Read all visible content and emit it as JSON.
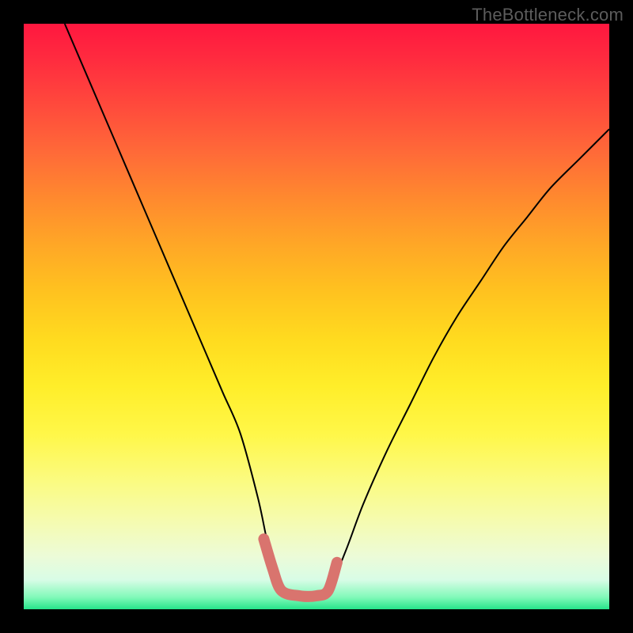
{
  "watermark": {
    "text": "TheBottleneck.com"
  },
  "chart_data": {
    "type": "line",
    "title": "",
    "xlabel": "",
    "ylabel": "",
    "xlim": [
      0,
      100
    ],
    "ylim": [
      0,
      100
    ],
    "grid": false,
    "legend": false,
    "series": [
      {
        "name": "curve",
        "color": "#000000",
        "stroke_width": 2,
        "x": [
          7,
          10,
          13,
          16,
          19,
          22,
          25,
          28,
          31,
          34,
          37,
          40,
          41.5,
          43,
          45,
          47,
          50,
          52,
          55,
          58,
          62,
          66,
          70,
          74,
          78,
          82,
          86,
          90,
          95,
          100
        ],
        "y": [
          100,
          93,
          86,
          79,
          72,
          65,
          58,
          51,
          44,
          37,
          30,
          19,
          12,
          6,
          3,
          2,
          2,
          3,
          10,
          18,
          27,
          35,
          43,
          50,
          56,
          62,
          67,
          72,
          77,
          82
        ]
      },
      {
        "name": "flat-highlight",
        "color": "#d9746e",
        "stroke_width": 14,
        "linecap": "round",
        "x": [
          41,
          42.5,
          44,
          47,
          50,
          52,
          53.5
        ],
        "y": [
          12,
          7,
          3.2,
          2.3,
          2.3,
          3.2,
          8
        ]
      }
    ]
  }
}
